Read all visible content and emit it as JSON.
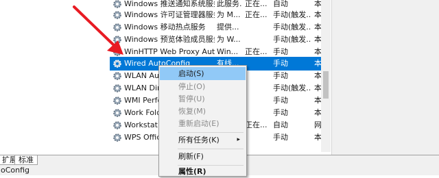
{
  "services": [
    {
      "name": "Windows 推送通知系统服务",
      "desc": "此服务...",
      "status": "正在...",
      "startup": "自动",
      "logon": "本"
    },
    {
      "name": "Windows 许可证管理器服务",
      "desc": "为 M...",
      "status": "正在...",
      "startup": "手动(触发...",
      "logon": "本"
    },
    {
      "name": "Windows 移动热点服务",
      "desc": "提供...",
      "status": "",
      "startup": "手动(触发...",
      "logon": "本"
    },
    {
      "name": "Windows 预览体验成员服务",
      "desc": "为 W...",
      "status": "",
      "startup": "手动(触发...",
      "logon": "本"
    },
    {
      "name": "WinHTTP Web Proxy Aut...",
      "desc": "Win...",
      "status": "正在...",
      "startup": "手动",
      "logon": "本"
    },
    {
      "name": "Wired AutoConfig",
      "desc": "有线...",
      "status": "",
      "startup": "手动",
      "logon": "本"
    },
    {
      "name": "WLAN Auto",
      "desc": "",
      "status": "",
      "startup": "手动",
      "logon": "本"
    },
    {
      "name": "WLAN Dire",
      "desc": "",
      "status": "",
      "startup": "手动(触发...",
      "logon": "本"
    },
    {
      "name": "WMI Perfo",
      "desc": "",
      "status": "",
      "startup": "手动",
      "logon": "本"
    },
    {
      "name": "Work Fold",
      "desc": "",
      "status": "",
      "startup": "手动",
      "logon": "本"
    },
    {
      "name": "Workstatio",
      "desc": "",
      "status": "正在...",
      "startup": "自动",
      "logon": "网"
    },
    {
      "name": "WPS Office",
      "desc": "",
      "status": "",
      "startup": "手动",
      "logon": "本"
    }
  ],
  "context_menu": {
    "start": "启动(S)",
    "stop": "停止(O)",
    "pause": "暂停(U)",
    "resume": "恢复(M)",
    "restart": "重新启动(E)",
    "all_tasks": "所有任务(K)",
    "refresh": "刷新(F)",
    "properties": "属性(R)"
  },
  "tabs": {
    "extended": "扩展",
    "standard": "标准"
  },
  "statusbar": {
    "text": "oConfig"
  },
  "colors": {
    "selection": "#0078d7",
    "menu_highlight": "#91c9f7",
    "annotation": "#e81b23"
  }
}
